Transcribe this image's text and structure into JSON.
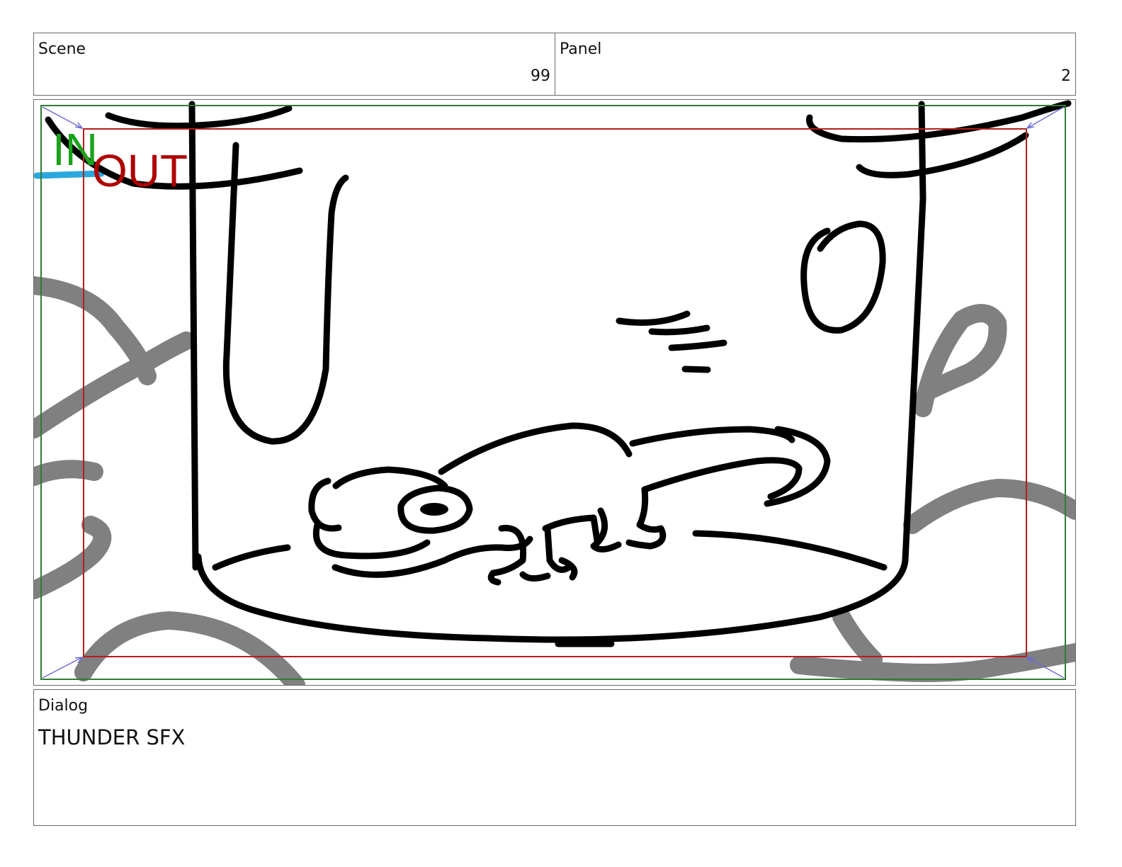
{
  "header": {
    "scene": {
      "label": "Scene",
      "value": "99"
    },
    "panel": {
      "label": "Panel",
      "value": "2"
    }
  },
  "frame": {
    "in_marker": "IN",
    "out_marker": "OUT",
    "colors": {
      "in_frame": "#2f7d32",
      "out_frame": "#b71c1c",
      "in_text": "#1aa31a",
      "out_text": "#b00000",
      "background_strokes": "#808080",
      "sketch": "#000000",
      "blue_mark": "#29a8e0"
    }
  },
  "dialog": {
    "label": "Dialog",
    "text": "THUNDER SFX"
  }
}
